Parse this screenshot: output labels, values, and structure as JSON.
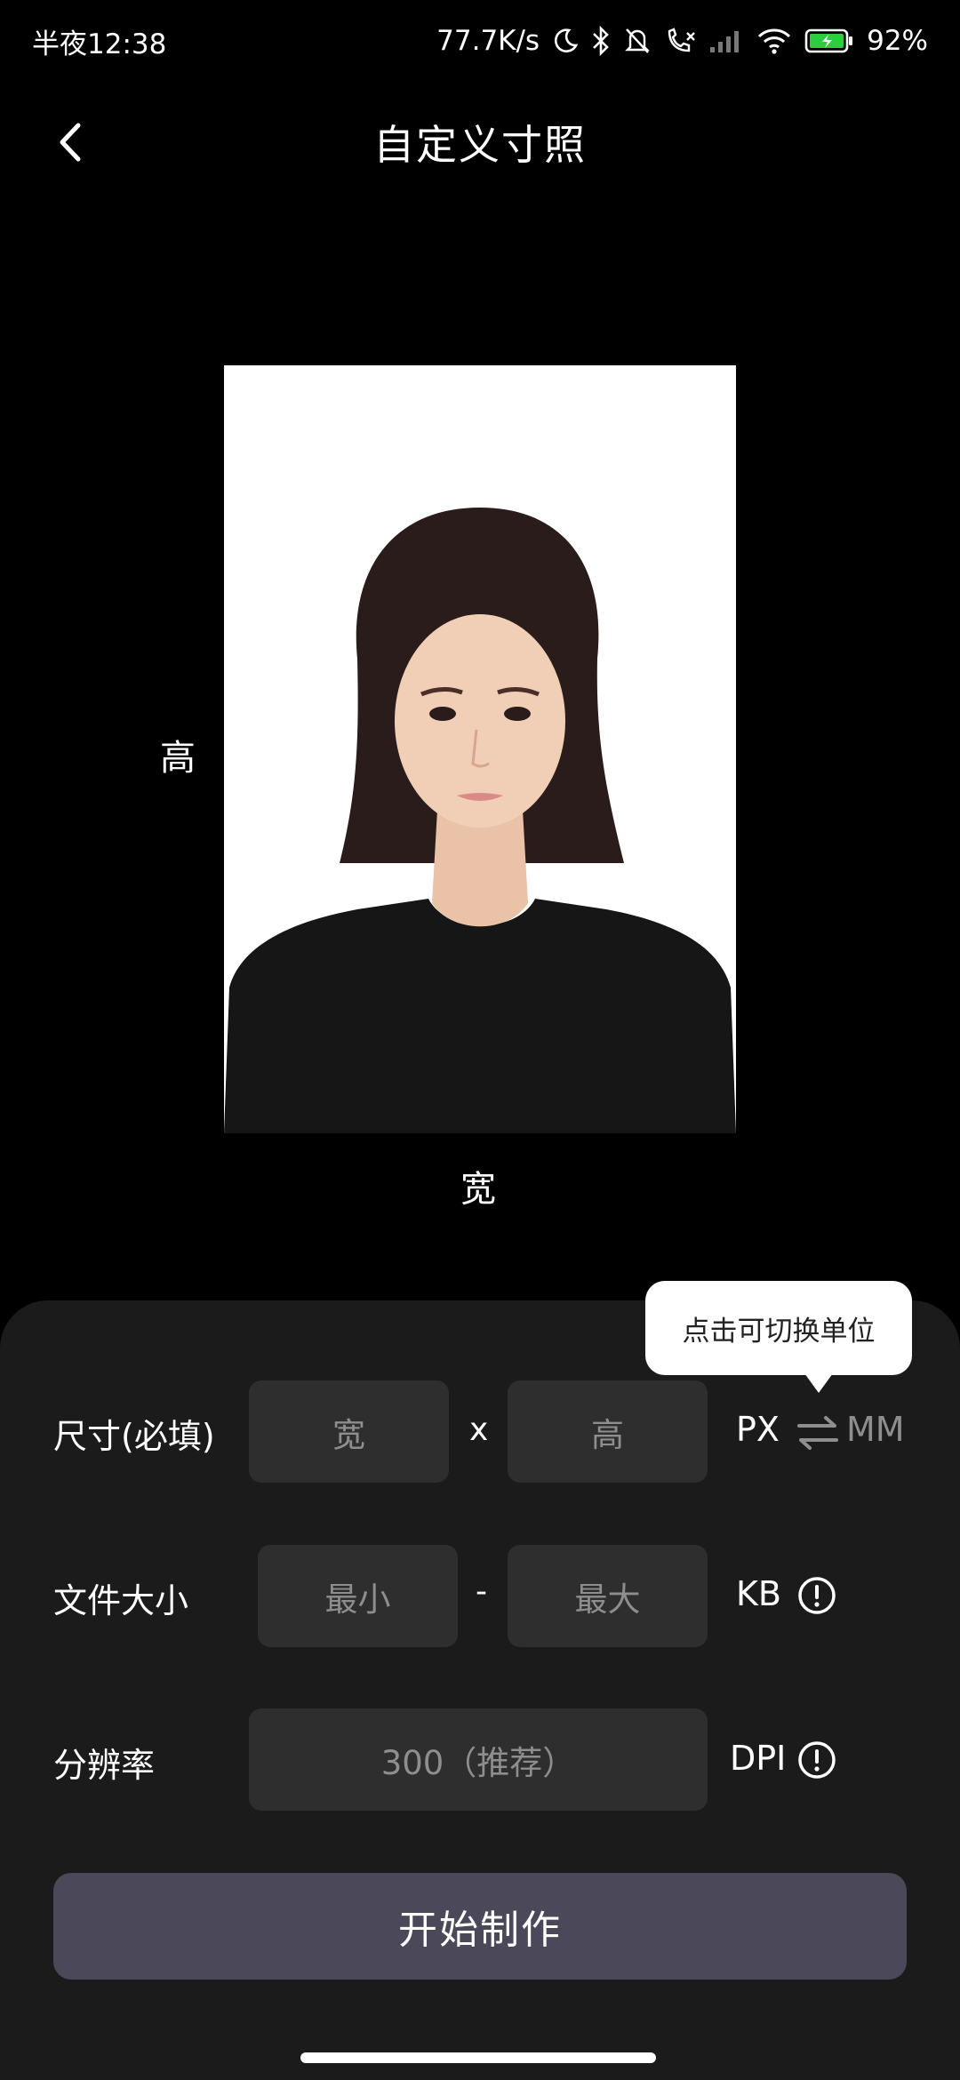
{
  "status": {
    "time": "半夜12:38",
    "net_speed": "77.7K/s",
    "battery": "92%"
  },
  "header": {
    "title": "自定义寸照"
  },
  "photo": {
    "height_label": "高",
    "width_label": "宽"
  },
  "tooltip": {
    "text": "点击可切换单位"
  },
  "size_row": {
    "label": "尺寸(必填)",
    "width_placeholder": "宽",
    "separator": "x",
    "height_placeholder": "高",
    "unit_active": "PX",
    "unit_inactive": "MM"
  },
  "filesize_row": {
    "label": "文件大小",
    "min_placeholder": "最小",
    "separator": "-",
    "max_placeholder": "最大",
    "unit": "KB"
  },
  "resolution_row": {
    "label": "分辨率",
    "placeholder": "300（推荐）",
    "unit": "DPI"
  },
  "start_button": {
    "label": "开始制作"
  },
  "colors": {
    "background": "#000000",
    "panel": "#1b1b1b",
    "field": "#2e2e2e",
    "button": "#4a4859",
    "battery_green": "#2ecc40"
  }
}
